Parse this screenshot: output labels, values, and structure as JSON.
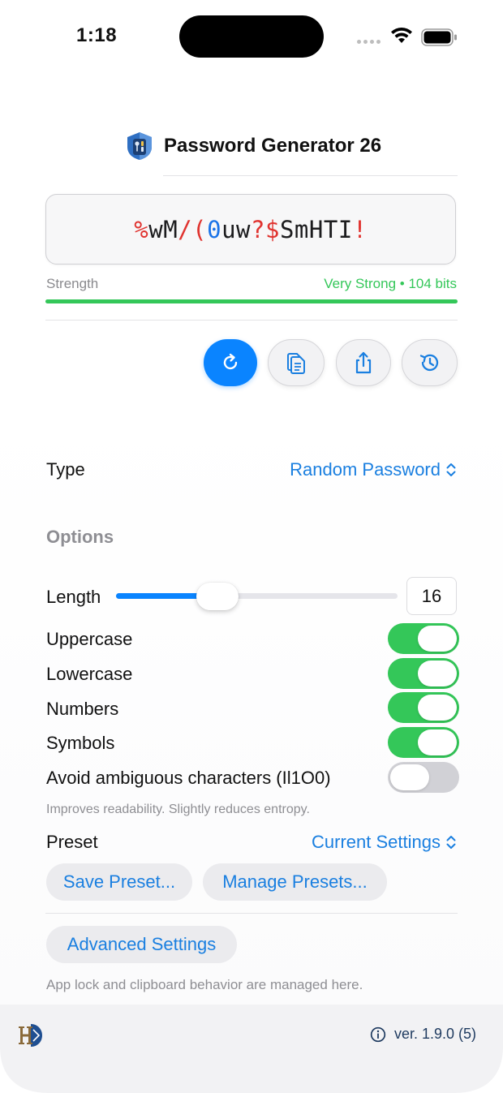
{
  "status_bar": {
    "time": "1:18"
  },
  "header": {
    "title": "Password Generator 26"
  },
  "password": {
    "chars": [
      {
        "c": "%",
        "k": "sym"
      },
      {
        "c": "w",
        "k": "let"
      },
      {
        "c": "M",
        "k": "let"
      },
      {
        "c": "/",
        "k": "sym"
      },
      {
        "c": "(",
        "k": "sym"
      },
      {
        "c": "0",
        "k": "num"
      },
      {
        "c": "u",
        "k": "let"
      },
      {
        "c": "w",
        "k": "let"
      },
      {
        "c": "?",
        "k": "sym"
      },
      {
        "c": "$",
        "k": "sym"
      },
      {
        "c": "S",
        "k": "let"
      },
      {
        "c": "m",
        "k": "let"
      },
      {
        "c": "H",
        "k": "let"
      },
      {
        "c": "T",
        "k": "let"
      },
      {
        "c": "I",
        "k": "let"
      },
      {
        "c": "!",
        "k": "sym"
      }
    ],
    "strength_label": "Strength",
    "strength_value": "Very Strong • 104 bits",
    "strength_fraction": 1.0
  },
  "type_row": {
    "label": "Type",
    "value": "Random Password"
  },
  "options": {
    "header": "Options",
    "length_label": "Length",
    "length_value": "16",
    "length_fraction": 0.36,
    "toggles": [
      {
        "label": "Uppercase",
        "on": true
      },
      {
        "label": "Lowercase",
        "on": true
      },
      {
        "label": "Numbers",
        "on": true
      },
      {
        "label": "Symbols",
        "on": true
      },
      {
        "label": "Avoid ambiguous characters (Il1O0)",
        "on": false
      }
    ],
    "ambiguous_hint": "Improves readability. Slightly reduces entropy."
  },
  "preset": {
    "label": "Preset",
    "value": "Current Settings",
    "save_label": "Save Preset...",
    "manage_label": "Manage Presets..."
  },
  "advanced": {
    "label": "Advanced Settings",
    "hint": "App lock and clipboard behavior are managed here."
  },
  "footer": {
    "version": "ver. 1.9.0 (5)"
  },
  "colors": {
    "accent": "#0a84ff",
    "link": "#1a7fe0",
    "toggle_on": "#34c759",
    "toggle_off": "#d1d1d6",
    "password_symbol": "#e0332f",
    "password_number": "#1a73e8"
  }
}
